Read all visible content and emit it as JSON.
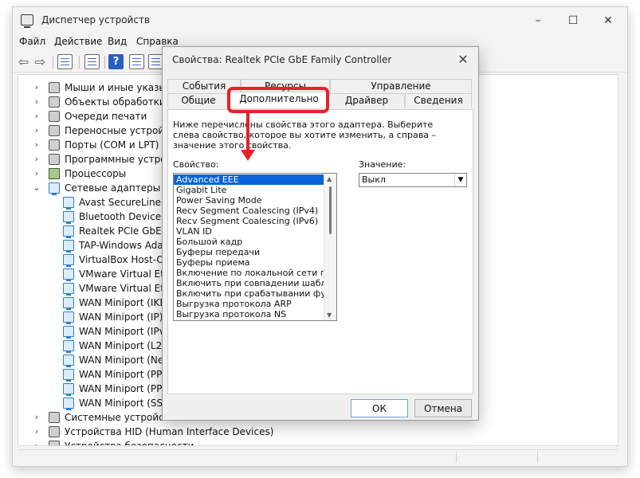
{
  "window": {
    "title": "Диспетчер устройств",
    "controls": [
      "–",
      "☐",
      "✕"
    ]
  },
  "menu": [
    "Файл",
    "Действие",
    "Вид",
    "Справка"
  ],
  "tree": [
    {
      "label": "Мыши и иные указыва",
      "chevron": "›",
      "icon": "mouse-icon"
    },
    {
      "label": "Объекты обработки зв",
      "chevron": "›",
      "icon": "audio-icon"
    },
    {
      "label": "Очереди печати",
      "chevron": "›",
      "icon": "printer-icon"
    },
    {
      "label": "Переносные устройств",
      "chevron": "›",
      "icon": "portable-device-icon"
    },
    {
      "label": "Порты (COM и LPT)",
      "chevron": "›",
      "icon": "port-icon"
    },
    {
      "label": "Программные устройс",
      "chevron": "›",
      "icon": "software-device-icon"
    },
    {
      "label": "Процессоры",
      "chevron": "›",
      "icon": "processor-icon"
    },
    {
      "label": "Сетевые адаптеры",
      "chevron": "⌄",
      "icon": "network-adapter-icon"
    },
    {
      "label": "Avast SecureLine Wi",
      "child": true,
      "icon": "network-adapter-icon"
    },
    {
      "label": "Bluetooth Device (Pe",
      "child": true,
      "icon": "network-adapter-icon"
    },
    {
      "label": "Realtek PCIe GbE Far",
      "child": true,
      "icon": "network-adapter-icon"
    },
    {
      "label": "TAP-Windows Adapt",
      "child": true,
      "icon": "network-adapter-icon"
    },
    {
      "label": "VirtualBox Host-Only",
      "child": true,
      "icon": "network-adapter-icon"
    },
    {
      "label": "VMware Virtual Ethe",
      "child": true,
      "icon": "network-adapter-icon"
    },
    {
      "label": "VMware Virtual Ethe",
      "child": true,
      "icon": "network-adapter-icon"
    },
    {
      "label": "WAN Miniport (IKEv",
      "child": true,
      "icon": "network-adapter-icon"
    },
    {
      "label": "WAN Miniport (IP)",
      "child": true,
      "icon": "network-adapter-icon"
    },
    {
      "label": "WAN Miniport (IPv6",
      "child": true,
      "icon": "network-adapter-icon"
    },
    {
      "label": "WAN Miniport (L2TP",
      "child": true,
      "icon": "network-adapter-icon"
    },
    {
      "label": "WAN Miniport (Netv",
      "child": true,
      "icon": "network-adapter-icon"
    },
    {
      "label": "WAN Miniport (PPP(",
      "child": true,
      "icon": "network-adapter-icon"
    },
    {
      "label": "WAN Miniport (PPT",
      "child": true,
      "icon": "network-adapter-icon"
    },
    {
      "label": "WAN Miniport (SSTF",
      "child": true,
      "icon": "network-adapter-icon"
    },
    {
      "label": "Системные устройства",
      "chevron": "›",
      "icon": "system-device-icon"
    },
    {
      "label": "Устройства HID (Human Interface Devices)",
      "chevron": "›",
      "icon": "hid-icon"
    },
    {
      "label": "Устройства безопасности",
      "chevron": "›",
      "icon": "security-device-icon"
    }
  ],
  "dialog": {
    "title": "Свойства: Realtek PCIe GbE Family Controller",
    "close": "✕",
    "tabs_back": [
      "События",
      "Ресурсы",
      "Управление электропитанием"
    ],
    "tabs_front": [
      "Общие",
      "Дополнительно",
      "Драйвер",
      "Сведения"
    ],
    "description": "Ниже перечислены свойства этого адаптера. Выберите слева свойство, которое вы хотите изменить, а справа – значение этого свойства.",
    "property_label": "Свойство:",
    "value_label": "Значение:",
    "properties": [
      "Advanced EEE",
      "Gigabit Lite",
      "Power Saving Mode",
      "Recv Segment Coalescing (IPv4)",
      "Recv Segment Coalescing (IPv6)",
      "VLAN ID",
      "Большой кадр",
      "Буферы передачи",
      "Буферы приема",
      "Включение по локальной сети после",
      "Включить при совпадении шаблона",
      "Включить при срабатывании функци",
      "Выгрузка протокола ARP",
      "Выгрузка протокола NS"
    ],
    "value": "Выкл",
    "ok": "ОК",
    "cancel": "Отмена"
  },
  "annotation_color": "#e8202a",
  "accent_color": "#0a64d8"
}
